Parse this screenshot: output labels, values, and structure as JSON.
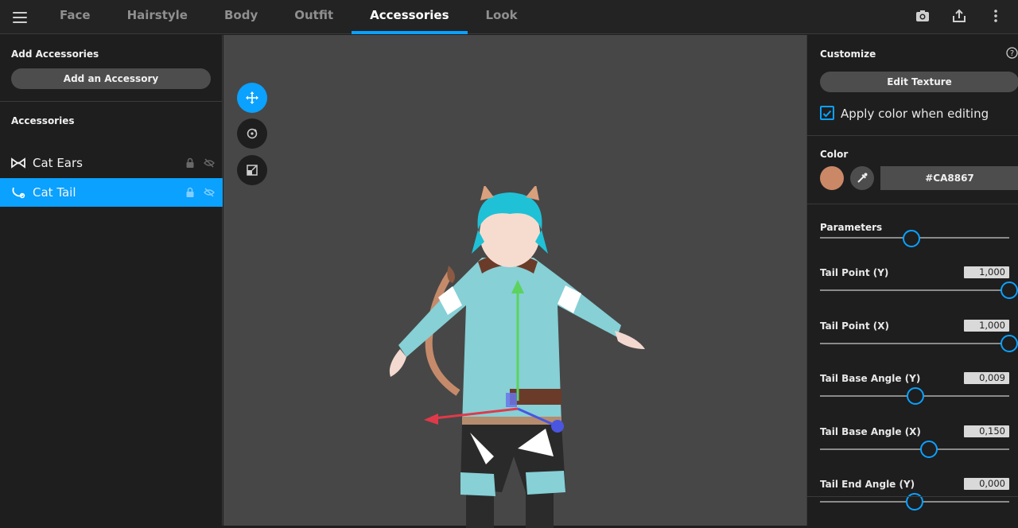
{
  "topbar": {
    "tabs": [
      {
        "label": "Face"
      },
      {
        "label": "Hairstyle"
      },
      {
        "label": "Body"
      },
      {
        "label": "Outfit"
      },
      {
        "label": "Accessories",
        "active": true
      },
      {
        "label": "Look"
      }
    ],
    "icons": [
      "camera-icon",
      "share-icon",
      "more-vertical-icon"
    ]
  },
  "left": {
    "add_title": "Add Accessories",
    "add_button": "Add an Accessory",
    "list_title": "Accessories",
    "items": [
      {
        "label": "Cat Ears",
        "icon": "cat-ears-icon",
        "selected": false
      },
      {
        "label": "Cat Tail",
        "icon": "cat-tail-icon",
        "selected": true
      }
    ]
  },
  "viewport": {
    "tools": [
      "move-icon",
      "rotate-icon",
      "scale-icon"
    ],
    "active_tool": "move-icon"
  },
  "right": {
    "customize_title": "Customize",
    "edit_texture": "Edit Texture",
    "apply_color_label": "Apply color when editing",
    "apply_color_checked": true,
    "color_title": "Color",
    "color_hex": "#CA8867",
    "parameters_title": "Parameters",
    "params": [
      {
        "label": "Tail Point (Y)",
        "value": "1,000",
        "fraction": 1.0
      },
      {
        "label": "Tail Point (X)",
        "value": "1,000",
        "fraction": 1.0
      },
      {
        "label": "Tail Base Angle (Y)",
        "value": "0,009",
        "fraction": 0.505
      },
      {
        "label": "Tail Base Angle (X)",
        "value": "0,150",
        "fraction": 0.575
      },
      {
        "label": "Tail End Angle (Y)",
        "value": "0,000",
        "fraction": 0.5
      }
    ]
  },
  "colors": {
    "accent": "#0AA1FF",
    "swatch": "#CA8867"
  }
}
